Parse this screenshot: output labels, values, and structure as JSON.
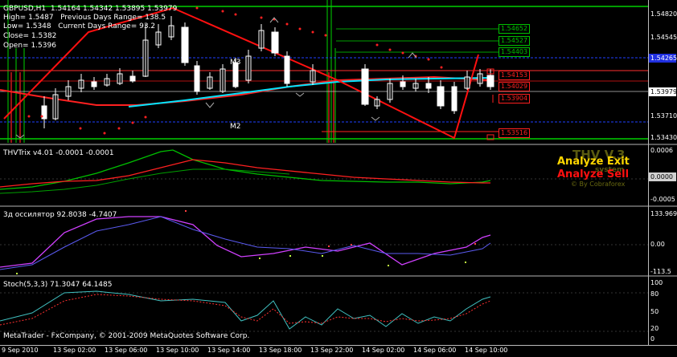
{
  "main": {
    "title": "GBPUSD,H1  1.54164 1.54342 1.53895 1.53979",
    "info_lines": [
      "High= 1.5487   Previous Days Range= 138.5",
      "Low= 1.5348   Current Days Range= 93.2",
      "Close= 1.5382",
      "Open= 1.5396"
    ],
    "labels": {
      "m3": "M3",
      "m2": "M2"
    },
    "price_ticks": [
      "1.54820",
      "1.54545",
      "1.54265",
      "1.53979",
      "1.53710",
      "1.53430"
    ],
    "current_price_tag": "1.53979",
    "blue_tag": "1.54265",
    "levels": [
      {
        "text": "1.54652",
        "color": "#00c000"
      },
      {
        "text": "1.54527",
        "color": "#00c000"
      },
      {
        "text": "1.54403",
        "color": "#00c000"
      },
      {
        "text": "1.54153",
        "color": "#ff2020"
      },
      {
        "text": "1.54029",
        "color": "#ff2020"
      },
      {
        "text": "1.53904",
        "color": "#ff2020"
      },
      {
        "text": "1.53516",
        "color": "#ff2020"
      }
    ]
  },
  "thv": {
    "title": "THVTrix v4.01 -0.0001 -0.0001",
    "ticks": [
      "0.0006",
      "0.0000",
      "-0.0005"
    ],
    "watermark": "THV V.3",
    "watermark_sub": "system",
    "analyze_exit": "Analyze Exit",
    "analyze_sell": "Analyze Sell",
    "by_line": "© By Cobraforex",
    "colors": {
      "exit": "#ffd700",
      "sell": "#ff1010"
    }
  },
  "osc": {
    "title": "3д оссилятор 92.8038 -4.7407",
    "ticks": [
      "133.969",
      "0.00",
      "-113.5"
    ]
  },
  "stoch": {
    "title": "Stoch(5,3,3) 71.3047 64.1485",
    "ticks": [
      "100",
      "80",
      "50",
      "20",
      "0"
    ]
  },
  "footer": {
    "copyright": "MetaTrader - FxCompany, © 2001-2009 MetaQuotes Software Corp."
  },
  "time_labels": [
    "9 Sep 2010",
    "13 Sep 02:00",
    "13 Sep 06:00",
    "13 Sep 10:00",
    "13 Sep 14:00",
    "13 Sep 18:00",
    "13 Sep 22:00",
    "14 Sep 02:00",
    "14 Sep 06:00",
    "14 Sep 10:00"
  ]
}
